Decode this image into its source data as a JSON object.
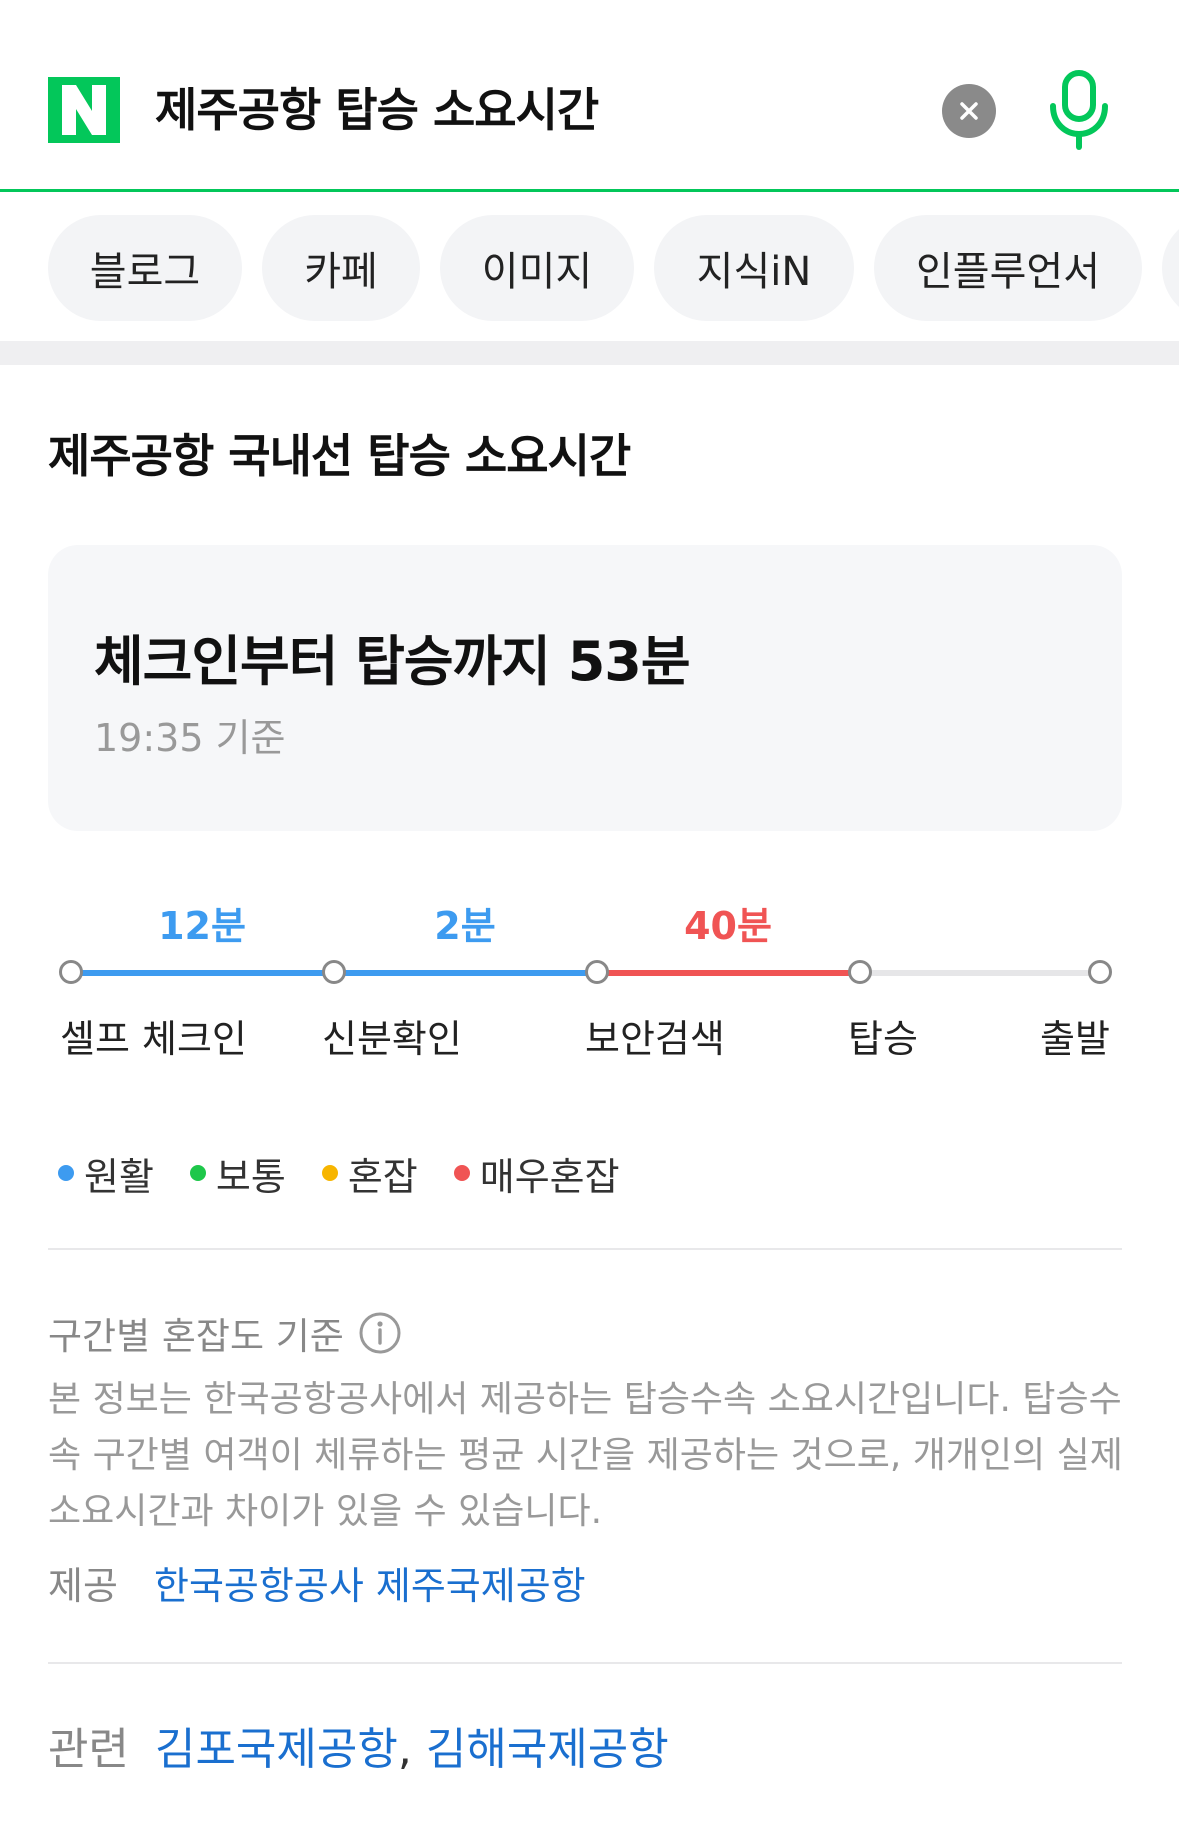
{
  "search": {
    "query": "제주공항 탑승 소요시간",
    "brand_color": "#03c75a",
    "logo_letter": "N"
  },
  "tabs": [
    {
      "label": "블로그"
    },
    {
      "label": "카페"
    },
    {
      "label": "이미지"
    },
    {
      "label": "지식iN"
    },
    {
      "label": "인플루언서"
    }
  ],
  "card": {
    "title": "제주공항 국내선 탑승 소요시간",
    "summary": "체크인부터 탑승까지 53분",
    "timestamp": "19:35 기준"
  },
  "timeline": {
    "segments": [
      {
        "duration": "12분",
        "status": "원활",
        "color": "#3d9bf0"
      },
      {
        "duration": "2분",
        "status": "원활",
        "color": "#3d9bf0"
      },
      {
        "duration": "40분",
        "status": "매우혼잡",
        "color": "#f05454"
      },
      {
        "duration": "",
        "status": "",
        "color": "#e6e6e8"
      }
    ],
    "stops": [
      "셀프 체크인",
      "신분확인",
      "보안검색",
      "탑승",
      "출발"
    ]
  },
  "legend": [
    {
      "label": "원활",
      "color": "#3d9bf0"
    },
    {
      "label": "보통",
      "color": "#1ec74a"
    },
    {
      "label": "혼잡",
      "color": "#f7b500"
    },
    {
      "label": "매우혼잡",
      "color": "#f05454"
    }
  ],
  "criteria": {
    "title": "구간별 혼잡도 기준",
    "description": "본 정보는 한국공항공사에서 제공하는 탑승수속 소요시간입니다. 탑승수속 구간별 여객이 체류하는 평균 시간을 제공하는 것으로, 개개인의 실제 소요시간과 차이가 있을 수 있습니다.",
    "provider_label": "제공",
    "provider_link": "한국공항공사 제주국제공항"
  },
  "related": {
    "label": "관련",
    "links": [
      "김포국제공항",
      "김해국제공항"
    ],
    "separator": ","
  }
}
